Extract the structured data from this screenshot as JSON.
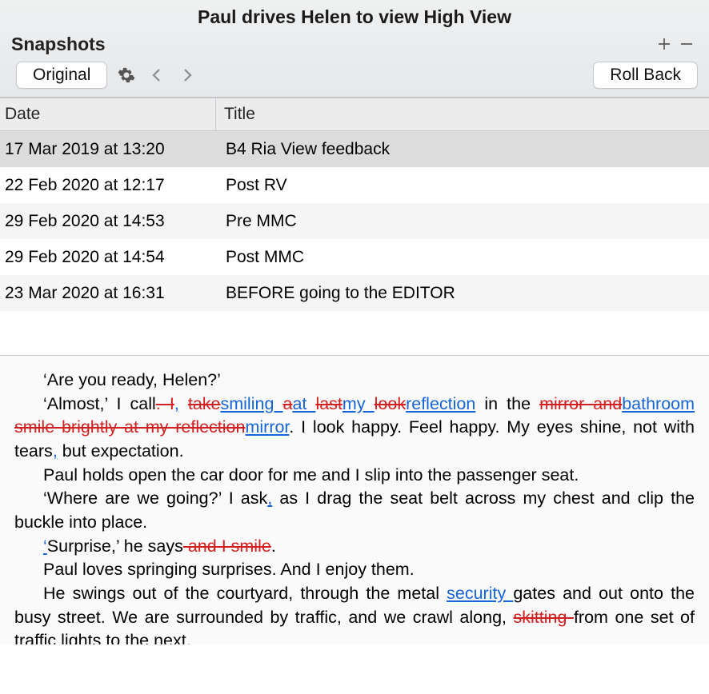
{
  "header": {
    "title": "Paul drives Helen to view High View",
    "snapshots_label": "Snapshots",
    "original_btn": "Original",
    "rollback_btn": "Roll Back"
  },
  "columns": {
    "date": "Date",
    "title": "Title"
  },
  "rows": [
    {
      "date": "17 Mar 2019 at 13:20",
      "title": "B4 Ria View feedback",
      "selected": true
    },
    {
      "date": "22 Feb 2020 at 12:17",
      "title": "Post RV",
      "selected": false
    },
    {
      "date": "29 Feb 2020 at 14:53",
      "title": "Pre MMC",
      "selected": false
    },
    {
      "date": "29 Feb 2020 at 14:54",
      "title": "Post MMC",
      "selected": false
    },
    {
      "date": "23 Mar 2020 at 16:31",
      "title": "BEFORE going to the EDITOR",
      "selected": false
    }
  ],
  "content": {
    "p1": {
      "t1": "‘Are you ready, Helen?’"
    },
    "p2": {
      "t1": "‘Almost,’ I call",
      "d1": ". I",
      "i1": ",",
      "t2": " ",
      "d2": "take",
      "i2": "smiling ",
      "d3": "a",
      "i3": "at ",
      "d4": "last",
      "i4": "my ",
      "d5": "look",
      "i5": "reflection",
      "t3": " in the ",
      "d6": "mirror and",
      "i6": "bathroom ",
      "d7": "smile brightly at my reflection",
      "i7": "mirror",
      "t4": ". I look happy. Feel happy. My eyes shine, not with tears",
      "i8": ",",
      "t5": " but expectation."
    },
    "p3": {
      "t1": "Paul holds open the car door for me and I slip into the passenger seat."
    },
    "p4": {
      "t1": "‘Where are we going?’ I ask",
      "i1": ",",
      "t2": " as I drag the seat belt across my chest and clip the buckle into place."
    },
    "p5": {
      "i1": "‘",
      "t1": "Surprise,’ he says",
      "d1": " and I smile",
      "t2": "."
    },
    "p6": {
      "t1": "Paul loves springing surprises. And I enjoy them."
    },
    "p7": {
      "t1": "He swings out of the courtyard, through the metal ",
      "i1": "security ",
      "t2": "gates and out onto the busy street. We are surrounded by traffic, and we crawl along, ",
      "d1": "skitting ",
      "t3": "from one set of traffic lights to the next."
    }
  }
}
